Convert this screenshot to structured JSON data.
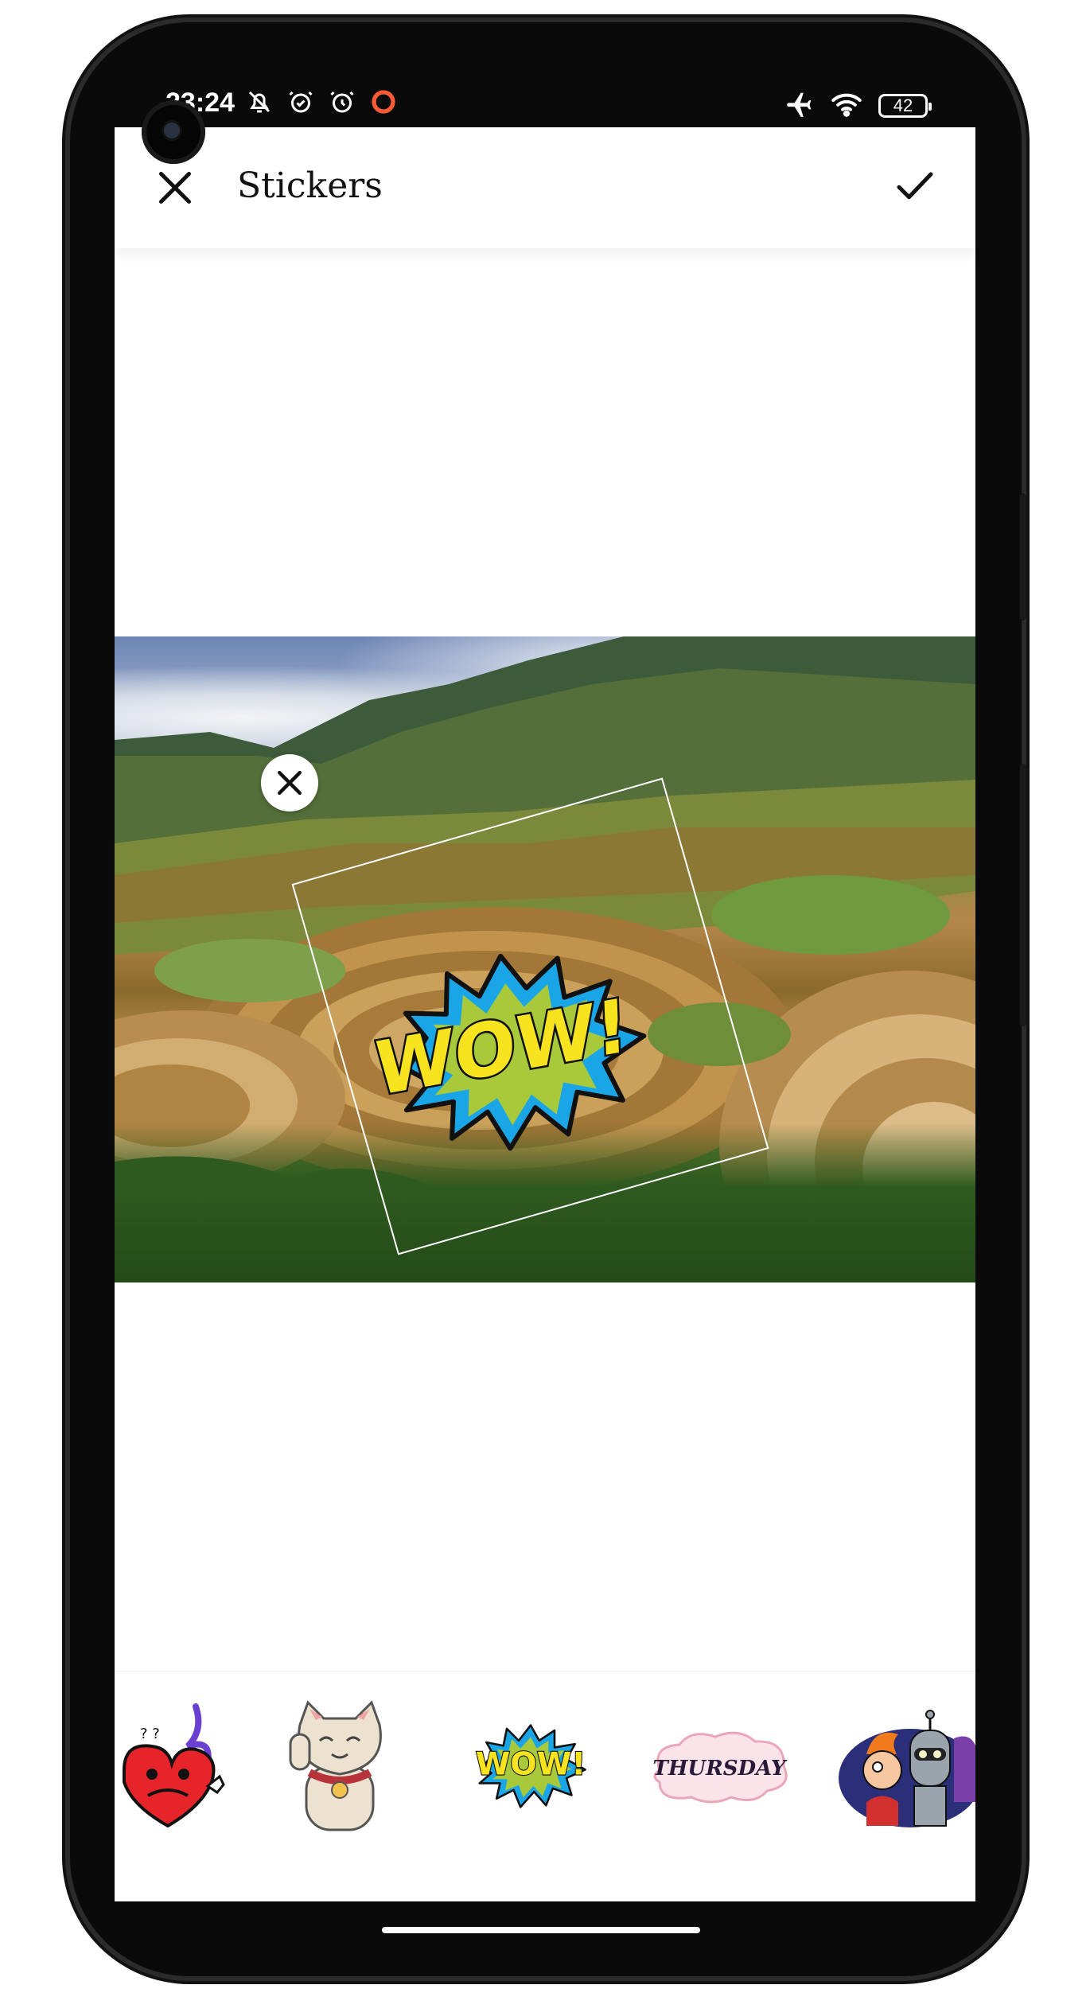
{
  "status_bar": {
    "time": "23:24",
    "battery_level": "42",
    "left_icons": [
      "bell-off-icon",
      "alarm-icon",
      "alarm-outline-icon",
      "record-icon"
    ],
    "right_icons": [
      "airplane-icon",
      "wifi-icon",
      "battery-icon"
    ]
  },
  "header": {
    "title": "Stickers",
    "close_icon": "close-icon",
    "confirm_icon": "check-icon"
  },
  "canvas": {
    "sticker_text": "WOW!",
    "delete_icon": "close-icon",
    "rotation_deg": -16
  },
  "tray": {
    "items": [
      {
        "name": "heart-devil-sticker"
      },
      {
        "name": "lucky-cat-sticker"
      },
      {
        "name": "wow-sticker",
        "text": "WOW!"
      },
      {
        "name": "thursday-sticker",
        "text": "THURSDAY"
      },
      {
        "name": "futurama-sticker"
      }
    ]
  },
  "colors": {
    "accent": "#ffffff",
    "wow_yellow": "#f7e41e",
    "wow_blue": "#1aa6e6",
    "wow_green": "#a8c93a",
    "record_red": "#ff5a36"
  }
}
